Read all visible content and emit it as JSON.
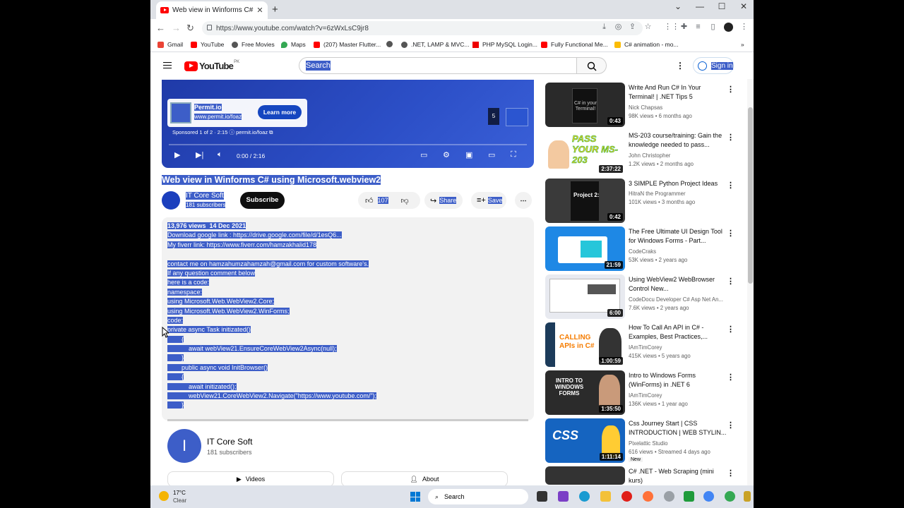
{
  "browser": {
    "tab_title": "Web view in Winforms C# using",
    "url": "https://www.youtube.com/watch?v=6zWxLsC9jr8",
    "bookmarks": [
      "Gmail",
      "YouTube",
      "Free Movies",
      "Maps",
      "(207) Master Flutter...",
      ".NET, LAMP & MVC...",
      "PHP MySQL Login...",
      "Fully Functional Me...",
      "C# animation - mo..."
    ]
  },
  "youtube": {
    "logo_text": "YouTube",
    "country_code": "PK",
    "search_placeholder": "Search",
    "sign_in": "Sign in"
  },
  "player": {
    "ad_title": "Permit.io",
    "ad_url": "www.permit.io/foaz",
    "ad_cta": "Learn more",
    "sponsored": "Sponsored 1 of 2 · 2:15",
    "sponsor_link": "permit.io/foaz",
    "skip_count": "5",
    "time": "0:00 / 2:16"
  },
  "video": {
    "title": "Web view in Winforms C# using Microsoft.webview2",
    "channel": "IT Core Soft",
    "subscribers": "181 subscribers",
    "subscribe": "Subscribe",
    "likes": "107",
    "share": "Share",
    "save": "Save"
  },
  "description": {
    "stats": "13,976 views  14 Dec 2021",
    "lines": [
      "Download google link : https://drive.google.com/file/d/1esQ6...",
      "My fiverr link: https://www.fiverr.com/hamzakhalid178",
      "",
      "contact me on hamzahumzahamzah@gmail.com for custom software's.",
      "If any question comment below",
      "here is a code:",
      "namespace:",
      "using Microsoft.Web.WebView2.Core;",
      "using Microsoft.Web.WebView2.WinForms;",
      "code:",
      "private async Task initizated()",
      "        {",
      "            await webView21.EnsureCoreWebView2Async(null);",
      "        }",
      "        public async void InitBrowser()",
      "        {",
      "            await initizated();",
      "            webView21.CoreWebView2.Navigate(\"https://www.youtube.com/\");",
      "        }"
    ]
  },
  "channel_card": {
    "initial": "I",
    "name": "IT Core Soft",
    "subscribers": "181 subscribers",
    "videos_tab": "Videos",
    "about_tab": "About"
  },
  "recommendations": [
    {
      "title": "Write And Run C# In Your Terminal! | .NET Tips 5",
      "channel": "Nick Chapsas",
      "meta": "98K views  •  6 months ago",
      "duration": "0:43",
      "thumb_text": "C# in your Terminal!"
    },
    {
      "title": "MS-203 course/training: Gain the knowledge needed to pass...",
      "channel": "John Christopher",
      "meta": "1.2K views  •  2 months ago",
      "duration": "2:37:22",
      "thumb_text": "PASS YOUR MS-203"
    },
    {
      "title": "3 SIMPLE Python Project Ideas",
      "channel": "HitraN the Programmer",
      "meta": "101K views  •  3 months ago",
      "duration": "0:42",
      "thumb_text": "Project 2:"
    },
    {
      "title": "The Free Ultimate UI Design Tool for Windows Forms - Part...",
      "channel": "CodeCraks",
      "meta": "53K views  •  2 years ago",
      "duration": "21:59",
      "thumb_text": ""
    },
    {
      "title": "Using WebView2 WebBrowser Control New...",
      "channel": "CodeDocu Developer C# Asp Net An...",
      "meta": "7.6K views  •  2 years ago",
      "duration": "6:00",
      "thumb_text": ""
    },
    {
      "title": "How To Call An API in C# - Examples, Best Practices,...",
      "channel": "IAmTimCorey",
      "meta": "415K views  •  5 years ago",
      "duration": "1:00:59",
      "thumb_text": "CALLING APIs in C#"
    },
    {
      "title": "Intro to Windows Forms (WinForms) in .NET 6",
      "channel": "IAmTimCorey",
      "meta": "136K views  •  1 year ago",
      "duration": "1:35:50",
      "thumb_text": "INTRO TO WINDOWS FORMS"
    },
    {
      "title": "Css Journey Start | CSS INTRODUCTION | WEB STYLIN...",
      "channel": "Pixelattic Studio",
      "meta": "616 views  •  Streamed 4 days ago",
      "duration": "1:11:14",
      "thumb_text": "CSS",
      "badge": "New"
    },
    {
      "title": "C# .NET - Web Scraping (mini kurs)",
      "channel": "",
      "meta": "",
      "duration": "",
      "thumb_text": ""
    }
  ],
  "taskbar": {
    "temp": "17°C",
    "weather": "Clear",
    "search": "Search"
  },
  "colors": {
    "selection": "#3d5ec8",
    "yt_red": "#ff0000",
    "subscribe_bg": "#0f0f0f"
  }
}
